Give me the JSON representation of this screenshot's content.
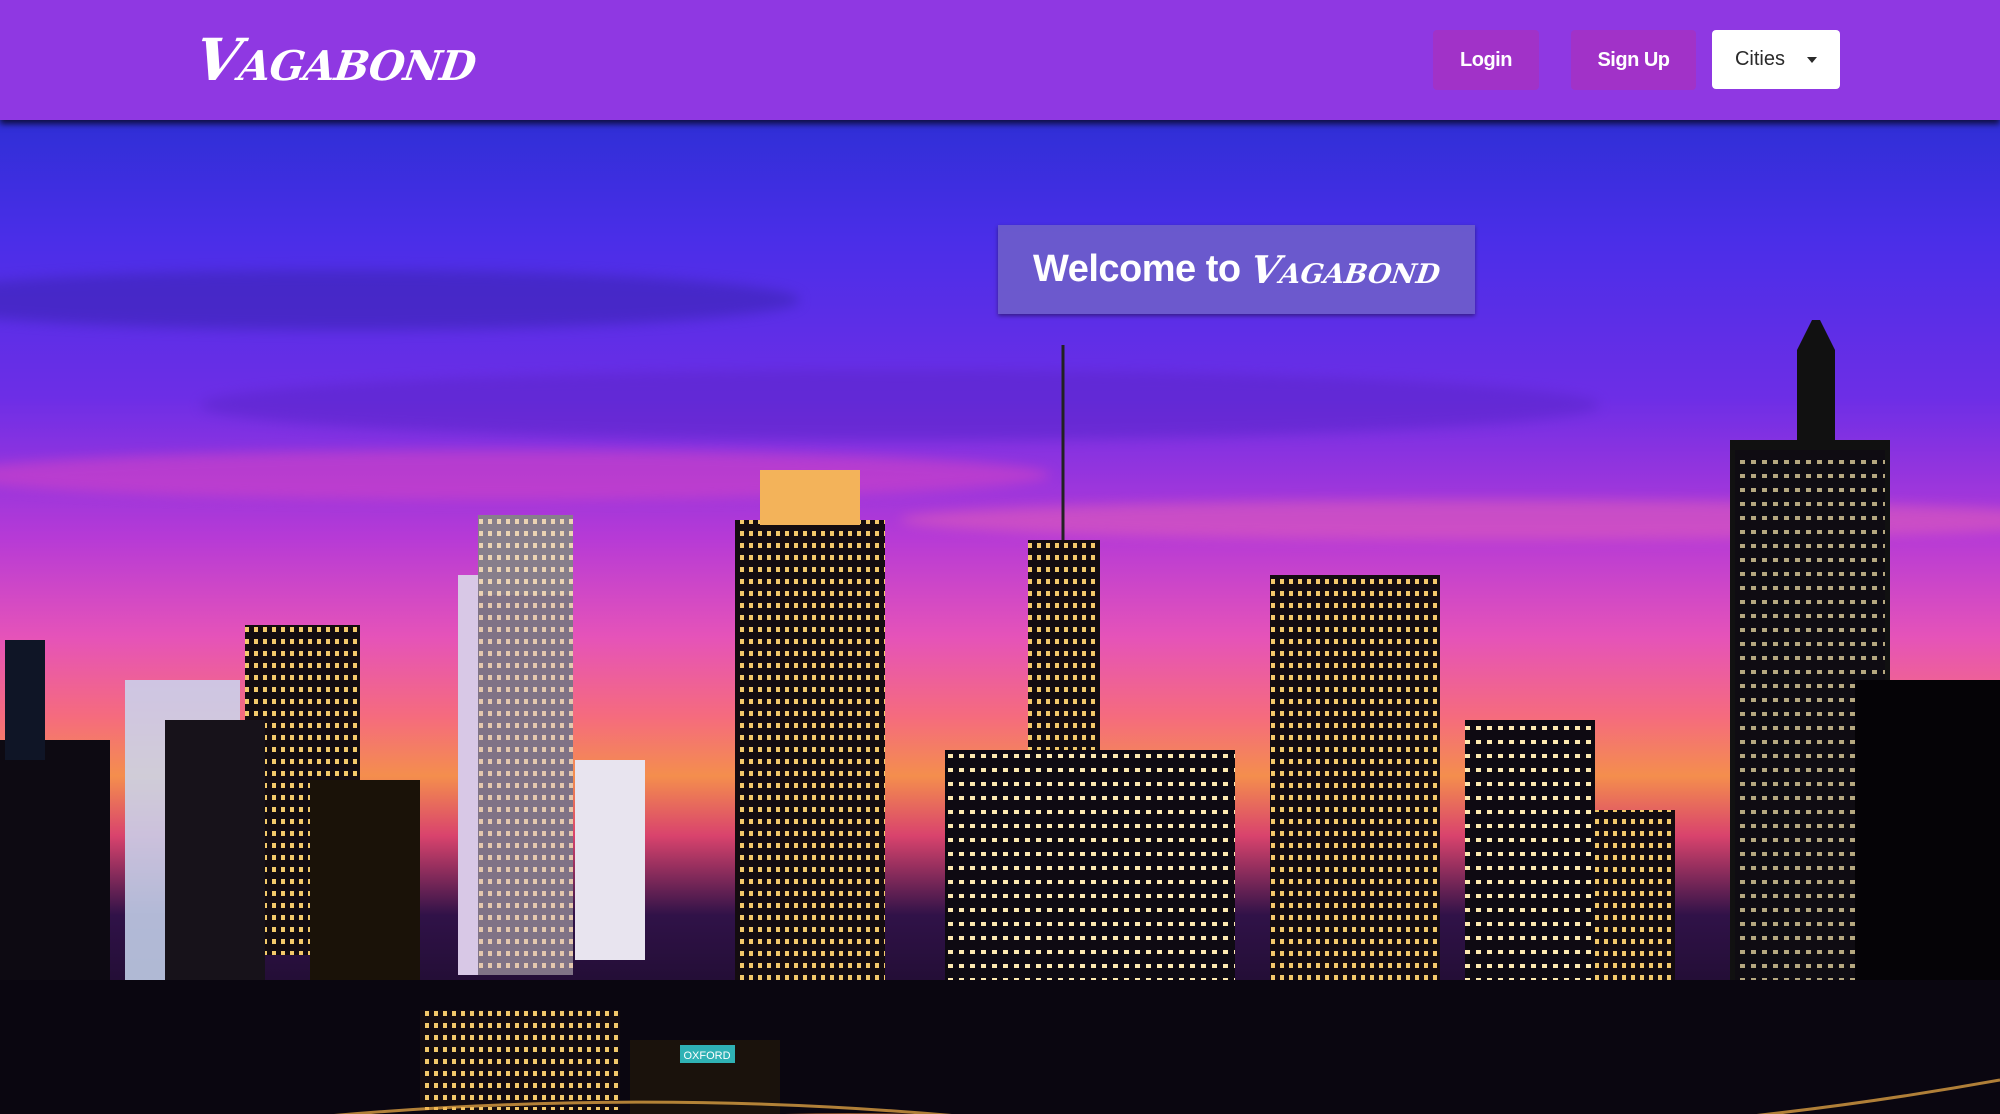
{
  "nav": {
    "brand": "Vagabond",
    "login_label": "Login",
    "signup_label": "Sign Up",
    "cities_label": "Cities"
  },
  "hero": {
    "welcome_prefix": "Welcome to",
    "welcome_brand": "Vagabond",
    "skyline_sign": "OXFORD"
  },
  "colors": {
    "navbar": "#8f38e2",
    "nav_button": "#a132c8",
    "welcome_box": "#7060c8"
  },
  "icons": {
    "cities_caret": "chevron-down-icon"
  }
}
